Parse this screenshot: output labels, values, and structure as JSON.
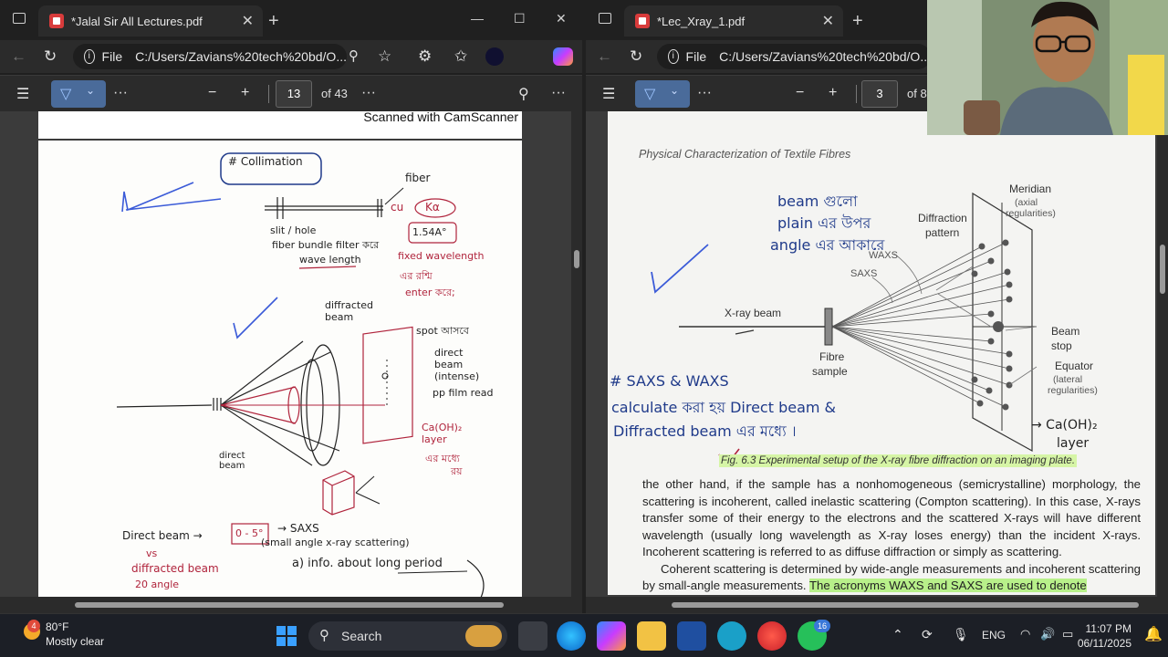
{
  "left_window": {
    "tab_title": "*Jalal Sir All Lectures.pdf",
    "url": "C:/Users/Zavians%20tech%20bd/O...",
    "url_prefix": "File",
    "page_current": "13",
    "page_total": "of 43",
    "scan_banner": "Scanned with CamScanner",
    "notes": {
      "collimation": "# Collimation",
      "fiber": "fiber",
      "cu": "cu",
      "kalpha": "Kα",
      "slit_hole": "slit / hole",
      "fiber_bundle": "fiber bundle filter করে",
      "wavelength": "1.54A°",
      "wavelength_label": "wave length",
      "fixed_wavelength": "fixed wavelength",
      "fixed_line2": "এর রশ্মি",
      "fixed_line3": "enter করে;",
      "diffracted_beam": "diffracted beam",
      "spot": "spot আসবে",
      "direct_beam": "direct beam (intense)",
      "pp_film": "pp film read",
      "caoh_layer": "Ca(OH)₂ layer",
      "caoh_line2": "এর মধ্যে",
      "caoh_line3": "রয়",
      "direct_bottom": "direct beam",
      "direct_beam_row": "Direct beam →",
      "range": "0 - 5°",
      "saxs": "→ SAXS",
      "saxs_full": "(small angle x-ray scattering)",
      "vs": "vs",
      "diffracted_row": "diffracted beam",
      "angle": "20 angle",
      "info": "a) info. about long period"
    }
  },
  "right_window": {
    "tab_title": "*Lec_Xray_1.pdf",
    "url": "C:/Users/Zavians%20tech%20bd/O...",
    "url_prefix": "File",
    "page_current": "3",
    "page_total": "of 8",
    "header": "Physical Characterization of Textile Fibres",
    "diagram": {
      "xray_beam": "X-ray beam",
      "fibre_sample_1": "Fibre",
      "fibre_sample_2": "sample",
      "diffraction_1": "Diffraction",
      "diffraction_2": "pattern",
      "waxs": "WAXS",
      "saxs": "SAXS",
      "meridian": "Meridian",
      "meridian_sub1": "(axial",
      "meridian_sub2": "regularities)",
      "beam_stop_1": "Beam",
      "beam_stop_2": "stop",
      "equator": "Equator",
      "equator_sub1": "(lateral",
      "equator_sub2": "regularities)"
    },
    "notes": {
      "bangla_1": "beam গুলো",
      "bangla_2": "plain এর উপর",
      "bangla_3": "angle এর আকারে",
      "saxs_waxs": "# SAXS & WAXS",
      "calc_line": "calculate করা হয় Direct beam &",
      "diff_line": "Diffracted beam এর মধ্যে ।",
      "caoh": "→ Ca(OH)₂",
      "layer": "layer"
    },
    "caption": "Fig. 6.3 Experimental setup of the X-ray fibre diffraction on an imaging plate.",
    "para1": "the other hand, if the sample has a nonhomogeneous (semicrystalline) morphology, the scattering is incoherent, called inelastic scattering (Compton scattering). In this case, X-rays transfer some of their energy to the electrons and the scattered X-rays will have different wavelength (usually long wavelength as X-ray loses energy) than the incident X-rays. Incoherent scattering is referred to as diffuse diffraction or simply as scattering.",
    "para2_a": "Coherent scattering is determined by wide-angle measurements and incoherent scattering by small-angle measurements. ",
    "para2_b": "The acronyms WAXS and SAXS are used to denote"
  },
  "taskbar": {
    "temperature": "80°F",
    "weather": "Mostly clear",
    "weather_badge": "4",
    "search_label": "Search",
    "language": "ENG",
    "time": "11:07 PM",
    "date": "06/11/2025",
    "whatsapp_badge": "16"
  },
  "icons": {
    "menu": "☰",
    "more": "···",
    "minus": "−",
    "plus": "+",
    "search": "⚲",
    "back": "←",
    "refresh": "↻",
    "close": "✕",
    "minimize": "—",
    "maximize": "☐",
    "highlight": "▽",
    "chevron": "⌄"
  }
}
